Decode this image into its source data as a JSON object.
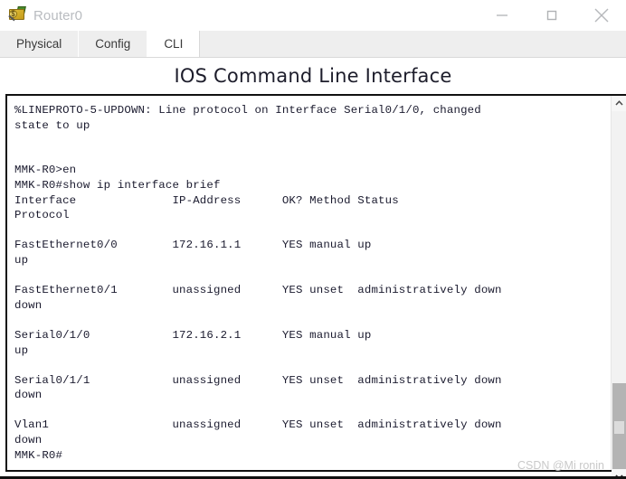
{
  "window": {
    "title": "Router0",
    "icon": "router-device-icon",
    "controls": [
      {
        "name": "minimize",
        "glyph": "minimize-icon"
      },
      {
        "name": "maximize",
        "glyph": "maximize-icon"
      },
      {
        "name": "close",
        "glyph": "close-icon"
      }
    ]
  },
  "tabs": [
    {
      "label": "Physical",
      "active": false
    },
    {
      "label": "Config",
      "active": false
    },
    {
      "label": "CLI",
      "active": true
    }
  ],
  "heading": "IOS Command Line Interface",
  "terminal": {
    "content": "%LINEPROTO-5-UPDOWN: Line protocol on Interface Serial0/1/0, changed\nstate to up\n\n\nMMK-R0>en\nMMK-R0#show ip interface brief\nInterface              IP-Address      OK? Method Status\nProtocol\n\nFastEthernet0/0        172.16.1.1      YES manual up\nup\n\nFastEthernet0/1        unassigned      YES unset  administratively down\ndown\n\nSerial0/1/0            172.16.2.1      YES manual up\nup\n\nSerial0/1/1            unassigned      YES unset  administratively down\ndown\n\nVlan1                  unassigned      YES unset  administratively down\ndown\nMMK-R0#",
    "prompt": "MMK-R0#",
    "hostname": "MMK-R0",
    "command": "show ip interface brief",
    "log_message": "%LINEPROTO-5-UPDOWN: Line protocol on Interface Serial0/1/0, changed state to up",
    "table": {
      "headers": [
        "Interface",
        "IP-Address",
        "OK?",
        "Method",
        "Status",
        "Protocol"
      ],
      "rows": [
        [
          "FastEthernet0/0",
          "172.16.1.1",
          "YES",
          "manual",
          "up",
          "up"
        ],
        [
          "FastEthernet0/1",
          "unassigned",
          "YES",
          "unset",
          "administratively down",
          "down"
        ],
        [
          "Serial0/1/0",
          "172.16.2.1",
          "YES",
          "manual",
          "up",
          "up"
        ],
        [
          "Serial0/1/1",
          "unassigned",
          "YES",
          "unset",
          "administratively down",
          "down"
        ],
        [
          "Vlan1",
          "unassigned",
          "YES",
          "unset",
          "administratively down",
          "down"
        ]
      ]
    }
  },
  "scrollbar": {
    "up_arrow": "chevron-up-icon",
    "down_arrow": "chevron-down-icon"
  },
  "watermark": "CSDN @Mi ronin",
  "colors": {
    "tabstrip_bg": "#eeeeee",
    "active_tab_bg": "#ffffff",
    "terminal_text": "#1a1a2e",
    "title_text": "#b9bcc0",
    "watermark_text": "#c9c9c9",
    "scroll_thumb": "#b4b4b4"
  }
}
